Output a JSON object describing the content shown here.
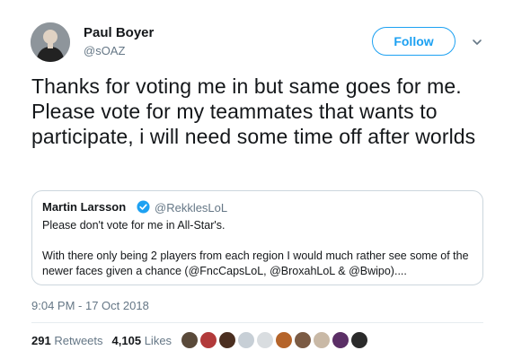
{
  "author": {
    "name": "Paul Boyer",
    "handle": "@sOAZ"
  },
  "follow": {
    "label": "Follow"
  },
  "tweet": {
    "text": "Thanks for voting me in but same goes for me. Please vote for my teammates that wants to participate, i will need some time off after worlds"
  },
  "quoted": {
    "name": "Martin Larsson",
    "handle": "@RekklesLoL",
    "text": "Please don't vote for me in All-Star's.\n\nWith there only being 2 players from each region I would much rather see some of the newer faces given a chance (@FncCapsLoL, @BroxahLoL & @Bwipo)...."
  },
  "timestamp": "9:04 PM - 17 Oct 2018",
  "stats": {
    "retweets_count": "291",
    "retweets_label": "Retweets",
    "likes_count": "4,105",
    "likes_label": "Likes"
  },
  "colors": {
    "accent": "#1da1f2",
    "muted": "#657786",
    "text": "#14171a",
    "border": "#ccd6dd"
  },
  "liker_colors": [
    "#5a4a3a",
    "#b23a3a",
    "#4b2f20",
    "#c7cfd6",
    "#d9dde0",
    "#b5642a",
    "#7b5b44",
    "#c9b9a6",
    "#5b2f66",
    "#2b2b2b"
  ]
}
